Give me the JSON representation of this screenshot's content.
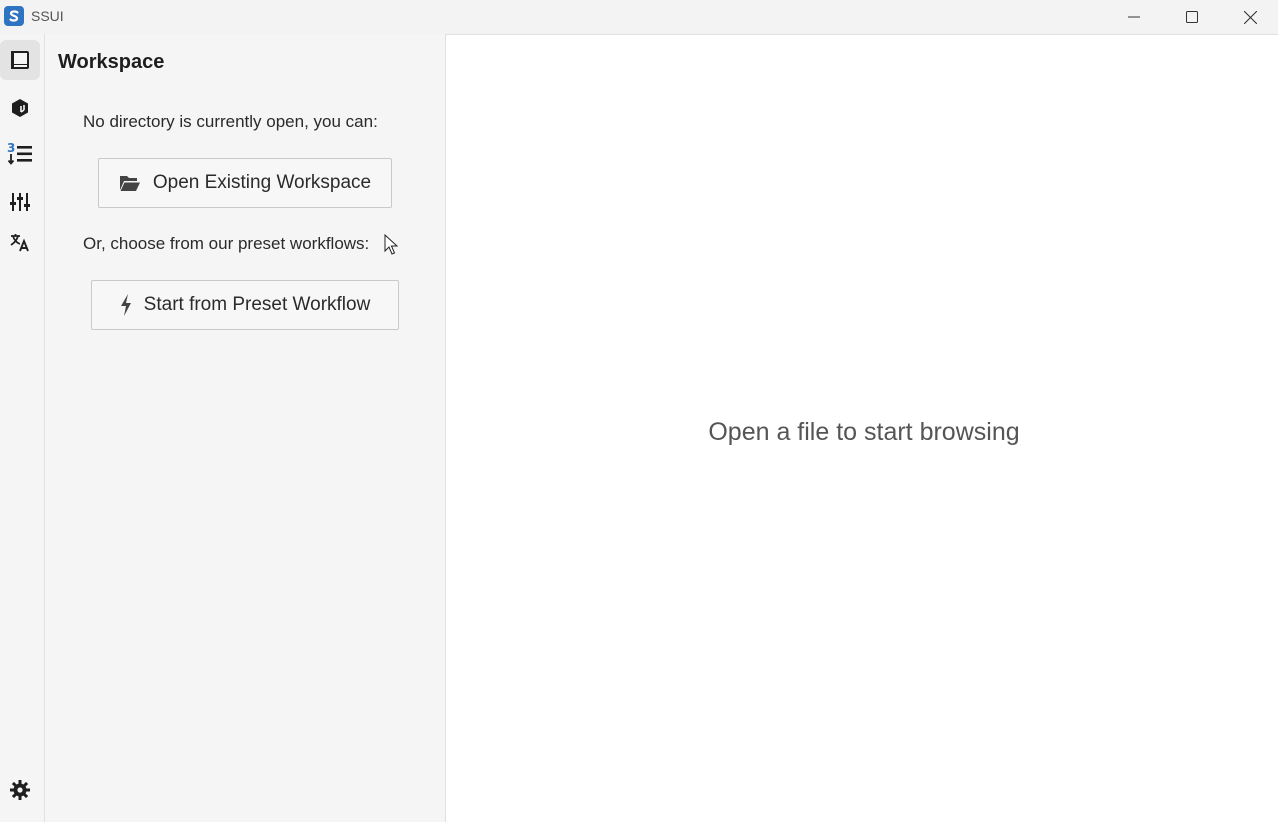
{
  "window": {
    "title": "SSUI",
    "minimize_icon": "minimize-icon",
    "maximize_icon": "maximize-icon",
    "close_icon": "close-icon"
  },
  "activity_bar": {
    "items": [
      {
        "name": "workspace",
        "icon": "book-icon",
        "active": true
      },
      {
        "name": "models",
        "icon": "cube-icon",
        "active": false
      },
      {
        "name": "queue",
        "icon": "numbered-list-icon",
        "active": false
      },
      {
        "name": "tweaks",
        "icon": "sliders-icon",
        "active": false
      },
      {
        "name": "language",
        "icon": "translate-icon",
        "active": false
      }
    ],
    "settings_icon": "gear-icon"
  },
  "sidebar": {
    "title": "Workspace",
    "no_directory_text": "No directory is currently open, you can:",
    "open_button_label": "Open Existing Workspace",
    "or_text": "Or, choose from our preset workflows:",
    "preset_button_label": "Start from Preset Workflow"
  },
  "main": {
    "empty_message": "Open a file to start browsing"
  },
  "colors": {
    "accent": "#2f74c0",
    "sidebar_bg": "#f5f5f5",
    "titlebar_bg": "#f3f3f3"
  }
}
